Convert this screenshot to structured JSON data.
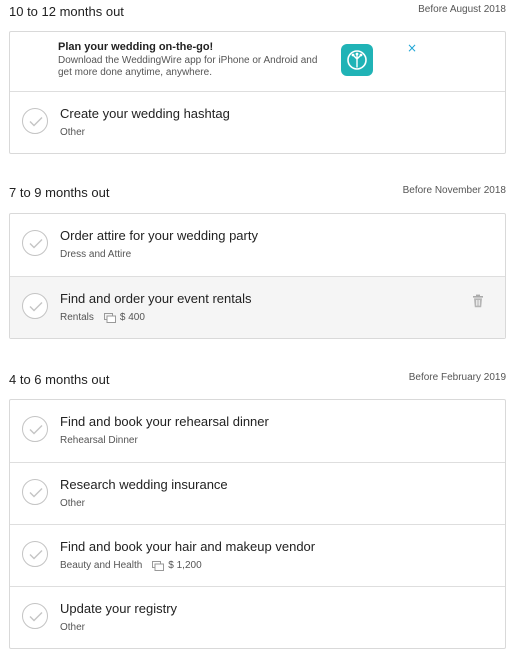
{
  "sections": [
    {
      "title": "10 to 12 months out",
      "date": "Before August 2018",
      "promo": {
        "title": "Plan your wedding on-the-go!",
        "text": "Download the WeddingWire app for iPhone or Android and get more done anytime, anywhere.",
        "close": "×",
        "app_icon": "weddingwire-app-icon"
      },
      "tasks": [
        {
          "title": "Create your wedding hashtag",
          "category": "Other"
        }
      ]
    },
    {
      "title": "7 to 9 months out",
      "date": "Before November 2018",
      "tasks": [
        {
          "title": "Order attire for your wedding party",
          "category": "Dress and Attire"
        },
        {
          "title": "Find and order your event rentals",
          "category": "Rentals",
          "cost": "$ 400"
        }
      ]
    },
    {
      "title": "4 to 6 months out",
      "date": "Before February 2019",
      "tasks": [
        {
          "title": "Find and book your rehearsal dinner",
          "category": "Rehearsal Dinner"
        },
        {
          "title": "Research wedding insurance",
          "category": "Other"
        },
        {
          "title": "Find and book your hair and makeup vendor",
          "category": "Beauty and Health",
          "cost": "$ 1,200"
        },
        {
          "title": "Update your registry",
          "category": "Other"
        }
      ]
    }
  ],
  "colors": {
    "accent": "#1fa6d6",
    "app_icon_bg": "#20b3b6",
    "border": "#d9d9d9",
    "hover_row": "#f5f5f5"
  }
}
